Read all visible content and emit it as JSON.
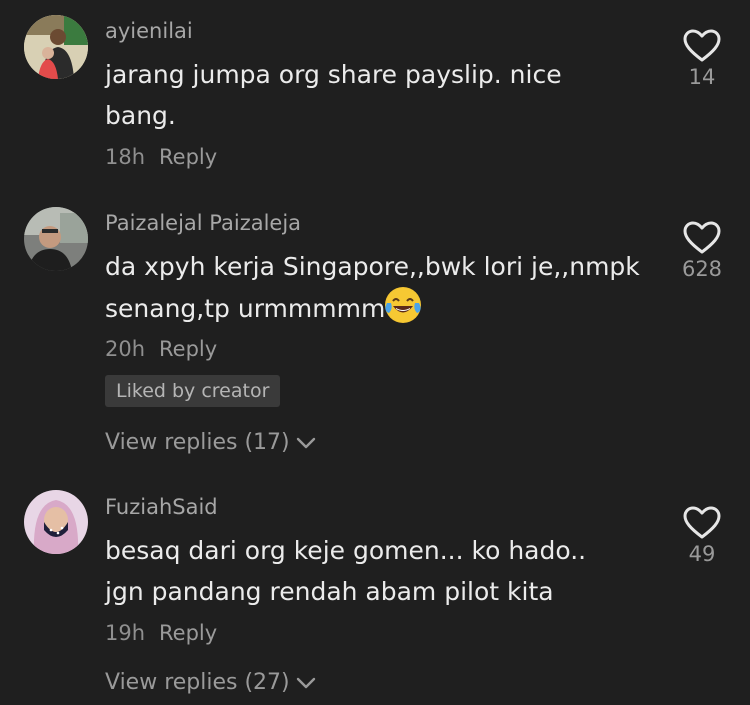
{
  "comments": [
    {
      "username": "ayienilai",
      "text": "jarang jumpa org share payslip. nice bang.",
      "time": "18h",
      "reply_label": "Reply",
      "like_count": "14"
    },
    {
      "username": "Paizalejal Paizaleja",
      "text": "da xpyh kerja Singapore,,bwk lori je,,nmpk senang,tp urmmmmm",
      "emoji": "face-with-tears-of-joy",
      "time": "20h",
      "reply_label": "Reply",
      "like_count": "628",
      "badge": "Liked by creator",
      "view_replies": "View replies (17)"
    },
    {
      "username": "FuziahSaid",
      "text": "besaq dari org keje gomen... ko hado.. jgn pandang rendah abam pilot kita",
      "time": "19h",
      "reply_label": "Reply",
      "like_count": "49",
      "view_replies": "View replies (27)"
    }
  ],
  "icons": {
    "like": "heart-outline-icon",
    "expand": "chevron-down-icon"
  },
  "colors": {
    "background": "#1f1f1f",
    "primary_text": "#ebebeb",
    "secondary_text": "#9a9a9a",
    "badge_bg": "#3a3a3a"
  }
}
